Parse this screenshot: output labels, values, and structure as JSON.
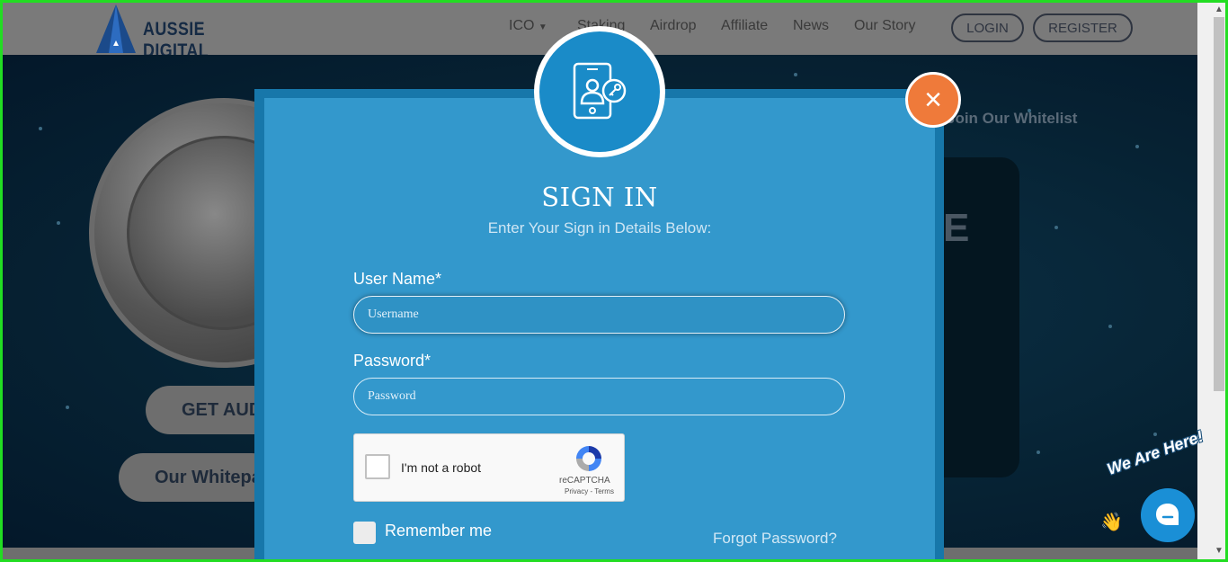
{
  "header": {
    "brand": "AUSSIE DIGITAL",
    "nav": [
      {
        "label": "ICO",
        "has_dropdown": true
      },
      {
        "label": "Staking"
      },
      {
        "label": "Airdrop"
      },
      {
        "label": "Affiliate"
      },
      {
        "label": "News"
      },
      {
        "label": "Our Story"
      }
    ],
    "login_label": "LOGIN",
    "register_label": "REGISTER"
  },
  "background": {
    "buy_button": "GET AUD",
    "whitepaper_button": "Our Whitepa",
    "whitelist_text": "Join Our Whitelist",
    "partial_heading": "E"
  },
  "modal": {
    "title": "SIGN IN",
    "subtitle": "Enter Your Sign in Details Below:",
    "username_label": "User Name*",
    "username_placeholder": "Username",
    "password_label": "Password*",
    "password_placeholder": "Password",
    "captcha_label": "I'm not a robot",
    "captcha_brand": "reCAPTCHA",
    "captcha_terms": "Privacy - Terms",
    "remember_label": "Remember me",
    "forgot_label": "Forgot Password?",
    "close_symbol": "×"
  },
  "chat": {
    "badge_text": "We Are Here!"
  },
  "colors": {
    "modal_bg": "#3398cc",
    "modal_border": "#1777aa",
    "close_button": "#ef7a3a",
    "chat_button": "#1a8fd6",
    "frame": "#22dd22"
  }
}
